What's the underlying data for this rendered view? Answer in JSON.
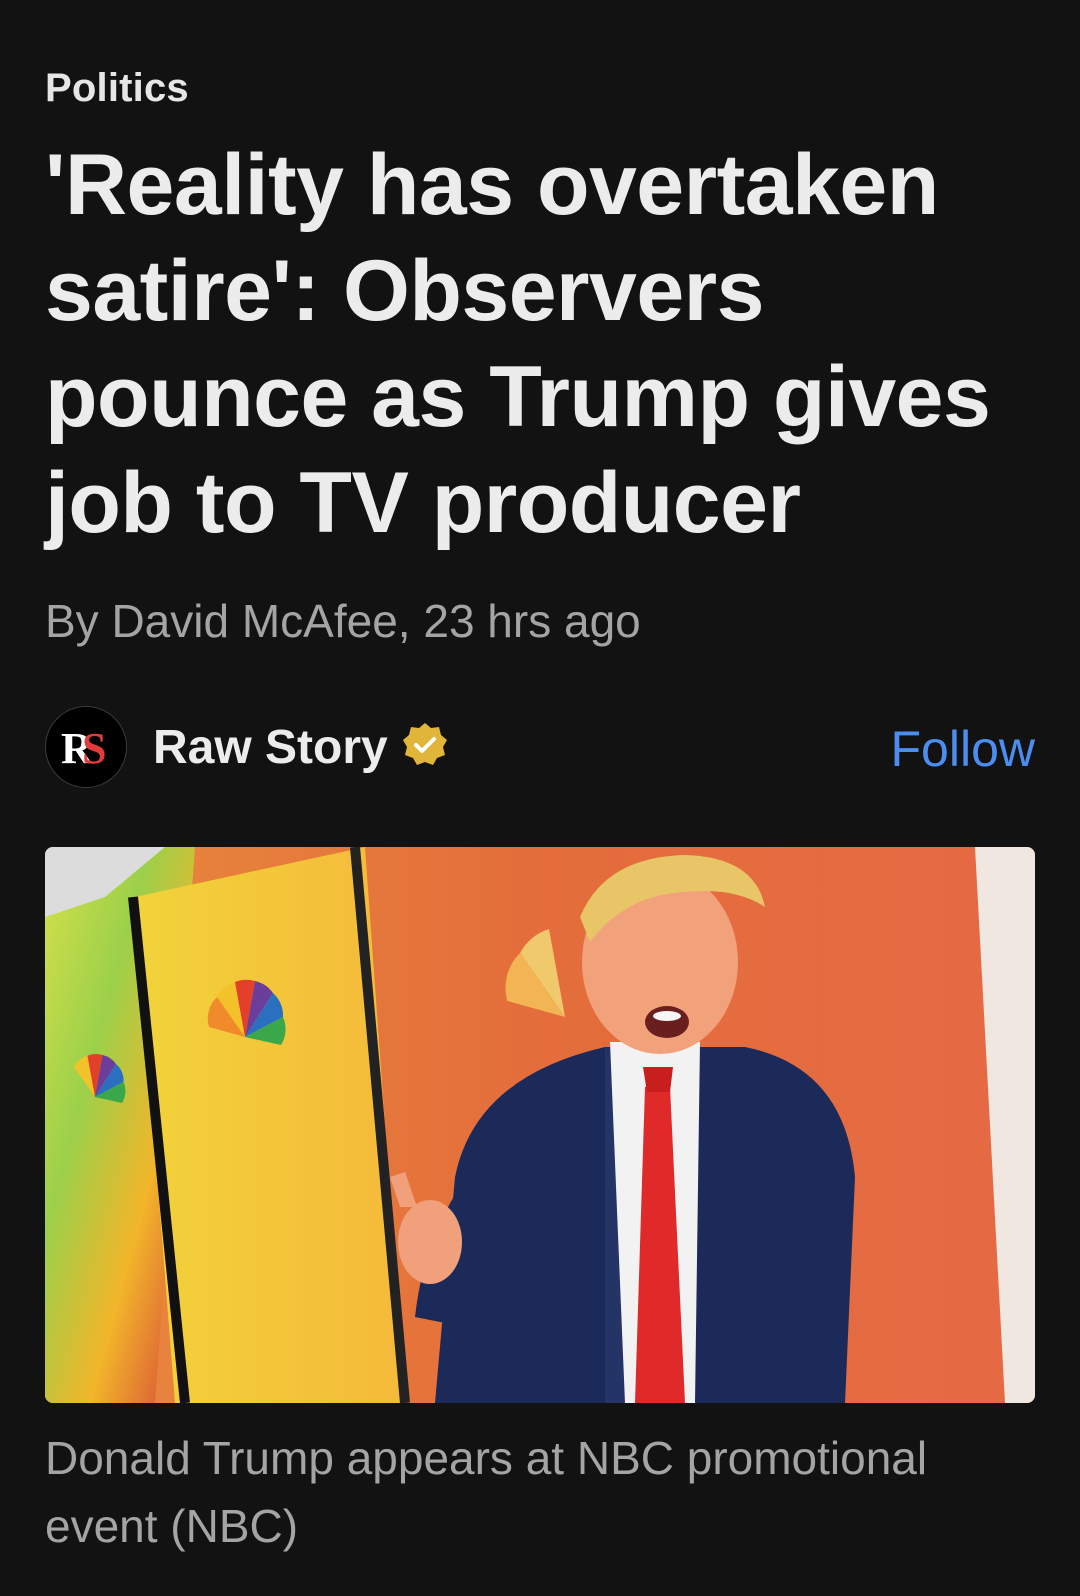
{
  "article": {
    "category": "Politics",
    "headline": "'Reality has overtaken satire': Observers pounce as Trump gives job to TV producer",
    "byline": "By David McAfee, 23 hrs ago"
  },
  "source": {
    "name": "Raw Story",
    "logo_text": "RS",
    "verified_icon": "verified-badge-icon",
    "follow_label": "Follow"
  },
  "image": {
    "caption": "Donald Trump appears at NBC promotional event (NBC)"
  },
  "colors": {
    "background": "#121212",
    "follow": "#4b8ef0",
    "verified": "#e0b53a"
  }
}
